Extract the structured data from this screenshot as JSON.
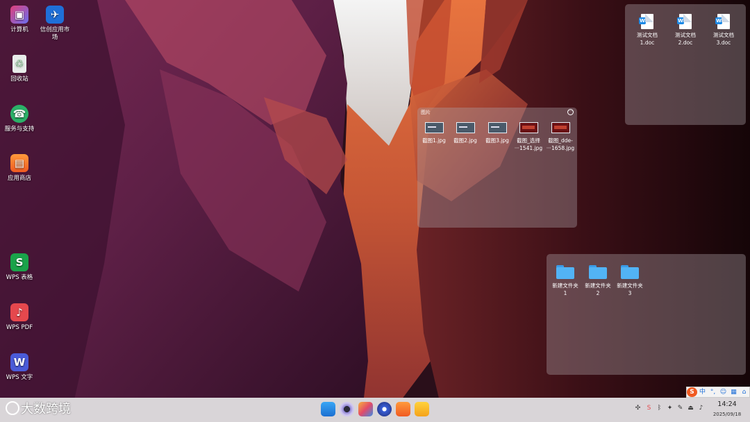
{
  "desktop_icons": [
    {
      "label": "计算机",
      "icon": "computer-icon"
    },
    {
      "label": "信创应用市场",
      "icon": "app-market-icon"
    },
    {
      "label": "回收站",
      "icon": "trash-icon"
    },
    {
      "label": "服务与支持",
      "icon": "support-icon"
    },
    {
      "label": "应用商店",
      "icon": "app-store-icon"
    },
    {
      "label": "WPS 表格",
      "icon": "wps-spreadsheet-icon"
    },
    {
      "label": "WPS PDF",
      "icon": "wps-pdf-icon"
    },
    {
      "label": "WPS 文字",
      "icon": "wps-writer-icon"
    }
  ],
  "docs_panel": {
    "items": [
      {
        "name_line1": "测试文档",
        "name_line2": "1.doc"
      },
      {
        "name_line1": "测试文档",
        "name_line2": "2.doc"
      },
      {
        "name_line1": "测试文档",
        "name_line2": "3.doc"
      }
    ]
  },
  "pictures_panel": {
    "title": "图片",
    "items": [
      {
        "name_line1": "截图1.jpg",
        "name_line2": ""
      },
      {
        "name_line1": "截图2.jpg",
        "name_line2": ""
      },
      {
        "name_line1": "截图3.jpg",
        "name_line2": ""
      },
      {
        "name_line1": "截图_选择",
        "name_line2": "···1541.jpg"
      },
      {
        "name_line1": "截图_dde-",
        "name_line2": "···1658.jpg"
      }
    ]
  },
  "folders_panel": {
    "items": [
      {
        "name_line1": "新建文件夹",
        "name_line2": "1"
      },
      {
        "name_line1": "新建文件夹",
        "name_line2": "2"
      },
      {
        "name_line1": "新建文件夹",
        "name_line2": "3"
      }
    ]
  },
  "ime": {
    "items": [
      "S",
      "中",
      "°,",
      "☺",
      "▦",
      "⌂"
    ]
  },
  "taskbar": {
    "watermark_text": "大数跨境",
    "clock": {
      "time": "14:24",
      "date": "2025/09/18"
    },
    "dock_apps": [
      "file-manager-icon",
      "camera-icon",
      "image-viewer-icon",
      "settings-icon",
      "app-store-icon",
      "notes-icon"
    ],
    "tray_icons": [
      "network-icon",
      "sogou-ime-icon",
      "bluetooth-icon",
      "notification-icon",
      "brush-icon",
      "eject-icon",
      "printer-icon",
      "volume-icon"
    ]
  },
  "colors": {
    "taskbar_bg": "#d9d5d8",
    "panel_bg": "rgba(170,160,165,0.38)",
    "folder_blue": "#52b3f5"
  }
}
